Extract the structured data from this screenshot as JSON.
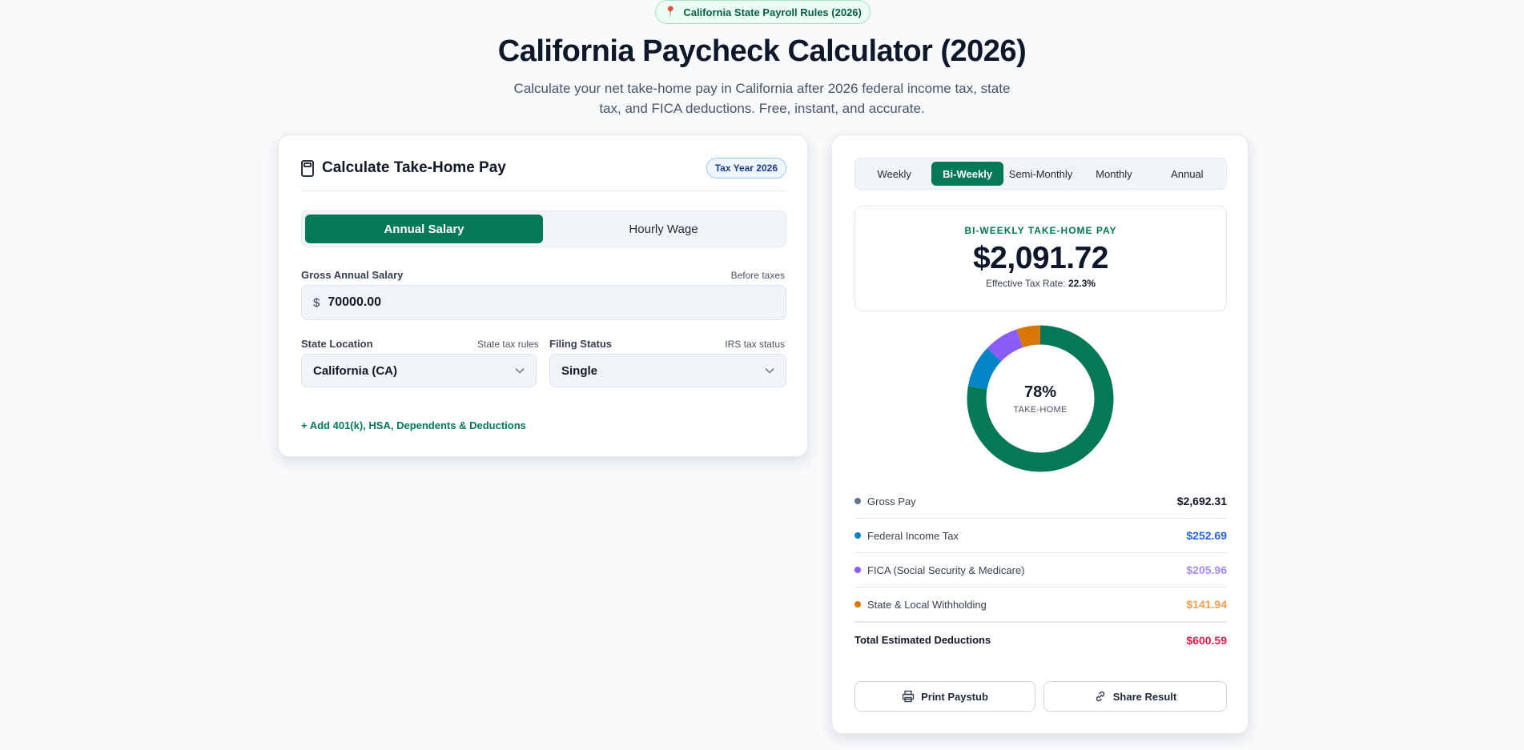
{
  "top_badge": {
    "icon": "pin-icon",
    "text": "California State Payroll Rules (2026)"
  },
  "page": {
    "title": "California Paycheck Calculator (2026)",
    "subtitle": "Calculate your net take-home pay in California after 2026 federal income tax, state tax, and FICA deductions. Free, instant, and accurate."
  },
  "calculator": {
    "title": "Calculate Take-Home Pay",
    "icon": "calculator-icon",
    "tax_year_badge": "Tax Year 2026",
    "modes": [
      {
        "label": "Annual Salary",
        "active": true
      },
      {
        "label": "Hourly Wage",
        "active": false
      }
    ],
    "salary": {
      "label": "Gross Annual Salary",
      "hint": "Before taxes",
      "currency": "$",
      "value": "70000.00"
    },
    "state": {
      "label": "State Location",
      "hint": "State tax rules",
      "value": "California (CA)"
    },
    "filing": {
      "label": "Filing Status",
      "hint": "IRS tax status",
      "value": "Single"
    },
    "add_link": "+ Add 401(k), HSA, Dependents & Deductions"
  },
  "results": {
    "periods": [
      {
        "label": "Weekly",
        "active": false
      },
      {
        "label": "Bi-Weekly",
        "active": true
      },
      {
        "label": "Semi-Monthly",
        "active": false
      },
      {
        "label": "Monthly",
        "active": false
      },
      {
        "label": "Annual",
        "active": false
      }
    ],
    "take_home_label": "BI-WEEKLY TAKE-HOME PAY",
    "take_home_amount": "$2,091.72",
    "effective_rate_label": "Effective Tax Rate:",
    "effective_rate_value": "22.3%",
    "donut_center_pct": "78%",
    "donut_center_label": "TAKE-HOME",
    "donut_segments": [
      {
        "name": "Take-Home",
        "value": 2091.72,
        "color": "#047857"
      },
      {
        "name": "Federal Income Tax",
        "value": 252.69,
        "color": "#0284c7"
      },
      {
        "name": "FICA",
        "value": 205.96,
        "color": "#8b5cf6"
      },
      {
        "name": "State & Local",
        "value": 141.94,
        "color": "#d97706"
      }
    ],
    "breakdown": [
      {
        "label": "Gross Pay",
        "value": "$2,692.31",
        "dot_color": "#64748b",
        "value_color": "#111827"
      },
      {
        "label": "Federal Income Tax",
        "value": "$252.69",
        "dot_color": "#0284c7",
        "value_color": "#2563eb"
      },
      {
        "label": "FICA (Social Security & Medicare)",
        "value": "$205.96",
        "dot_color": "#8b5cf6",
        "value_color": "#a78bfa"
      },
      {
        "label": "State & Local Withholding",
        "value": "$141.94",
        "dot_color": "#d97706",
        "value_color": "#f59e4b"
      }
    ],
    "total_label": "Total Estimated Deductions",
    "total_value": "$600.59",
    "actions": {
      "print_label": "Print Paystub",
      "print_icon": "printer-icon",
      "share_label": "Share Result",
      "share_icon": "link-icon"
    }
  }
}
